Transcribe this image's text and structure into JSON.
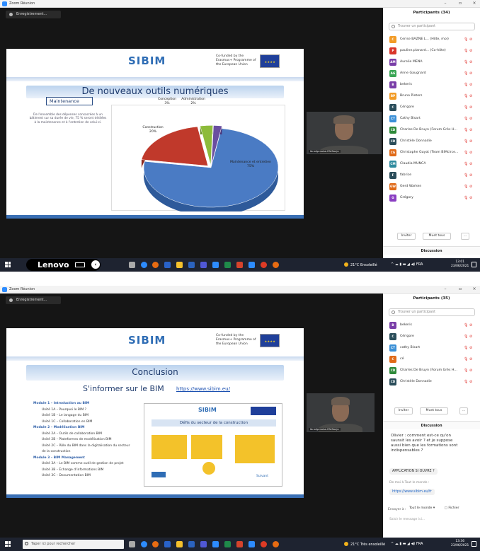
{
  "screenshot1": {
    "app_title": "Zoom Réunion",
    "recording_label": "Enregistrement...",
    "slide": {
      "logo": "SIBIM",
      "cofunded": "Co-funded by the Erasmus+ Programme of the European Union",
      "title": "De nouveaux outils numériques",
      "box_label": "Maintenance",
      "description": "De l'ensemble des dépenses consacrées à un bâtiment sur sa durée de vie, 75 % seront dédiées à la maintenance et à l'entretien de celui-ci."
    },
    "chart_data": {
      "type": "pie",
      "categories": [
        "Maintenance et entretien",
        "Construction",
        "Conception",
        "Administration"
      ],
      "values": [
        75,
        20,
        3,
        2
      ],
      "value_labels": [
        "75%",
        "20%",
        "3%",
        "2%"
      ]
    },
    "video_name": "Ibnafgenoise.EN.Boujo"
  },
  "panel1": {
    "title": "Participants (34)",
    "search_placeholder": "Trouver un participant",
    "participants": [
      {
        "initials": "C",
        "name": "Cerise BAZNE L... (Hôte, moi)",
        "color": "#f29b26"
      },
      {
        "initials": "P",
        "name": "pauline.planard... (Co-hôte)",
        "color": "#d9362b"
      },
      {
        "initials": "AM",
        "name": "Aurelie MENA",
        "color": "#7a3ea8"
      },
      {
        "initials": "AG",
        "name": "Anne Gaugnard",
        "color": "#3aa655"
      },
      {
        "initials": "B",
        "name": "bekeris",
        "color": "#7a3ea8"
      },
      {
        "initials": "BP",
        "name": "Bruno Pieters",
        "color": "#f29b26"
      },
      {
        "initials": "C",
        "name": "Cérigore",
        "color": "#2a4d5a"
      },
      {
        "initials": "CT",
        "name": "Cathy Bisart",
        "color": "#3a8fd6"
      },
      {
        "initials": "CD",
        "name": "Charles De Bruyn (Forum Grès H...",
        "color": "#2e8a3a"
      },
      {
        "initials": "CD",
        "name": "Christèle Donnadie",
        "color": "#2a4d5a"
      },
      {
        "initials": "CG",
        "name": "Christophe Guyot (Team BIMcirce...",
        "color": "#e06a18"
      },
      {
        "initials": "CM",
        "name": "Claudia MUNCA",
        "color": "#2e8a9e"
      },
      {
        "initials": "F",
        "name": "fabrice",
        "color": "#2a4d5a"
      },
      {
        "initials": "GW",
        "name": "Gerd Warken",
        "color": "#e06a18"
      },
      {
        "initials": "G",
        "name": "Grégory",
        "color": "#8a3ec2"
      }
    ],
    "invite": "Inviter",
    "mute_all": "Muet tous",
    "more": "...",
    "discussion": "Discussion"
  },
  "taskbar1": {
    "brand": "Lenovo",
    "weather": "21°C Ensoleillé",
    "lang": "FRA",
    "time": "13:01",
    "date": "23/06/2021"
  },
  "screenshot2": {
    "app_title": "Zoom Réunion",
    "recording_label": "Enregistrement...",
    "slide": {
      "logo": "SIBIM",
      "cofunded": "Co-funded by the Erasmus+ Programme of the European Union",
      "title": "Conclusion",
      "subtitle": "S'informer sur le BIM",
      "url": "https://www.sibim.eu/",
      "modules": [
        {
          "text": "Module 1 – Introduction au BIM",
          "head": true
        },
        {
          "text": "Unité 1A – Pourquoi le BIM ?",
          "head": false
        },
        {
          "text": "Unité 1B – Le langage du BIM",
          "head": false
        },
        {
          "text": "Unité 1C – Collaboration en BIM",
          "head": false
        },
        {
          "text": "Module 2 – Modélisation BIM",
          "head": true
        },
        {
          "text": "Unité 2A – Outils de collaboration BIM",
          "head": false
        },
        {
          "text": "Unité 2B – Plateformes de modélisation BIM",
          "head": false
        },
        {
          "text": "Unité 2C – Rôle du BIM dans la digitalisation du secteur",
          "head": false
        },
        {
          "text": "de la construction",
          "head": false
        },
        {
          "text": "Module 3 – BIM Management",
          "head": true
        },
        {
          "text": "Unité 3A – Le BIM comme outil de gestion de projet",
          "head": false
        },
        {
          "text": "Unité 3B – Échange d'informations BIM",
          "head": false
        },
        {
          "text": "Unité 3C – Documentation BIM",
          "head": false
        }
      ],
      "mini_title": "Défis du secteur de la construction",
      "mini_next": "Suivant"
    },
    "video_name": "Ibnafgenoise.EN.Boujo"
  },
  "panel2": {
    "title": "Participants (35)",
    "search_placeholder": "Trouver un participant",
    "participants": [
      {
        "initials": "B",
        "name": "bekeris",
        "color": "#7a3ea8"
      },
      {
        "initials": "C",
        "name": "Cérigore",
        "color": "#2a4d5a"
      },
      {
        "initials": "CT",
        "name": "cathy Bisart",
        "color": "#3a8fd6"
      },
      {
        "initials": "C",
        "name": "cé",
        "color": "#e06a18"
      },
      {
        "initials": "CD",
        "name": "Charles De Bruyn (Forum Grès H...",
        "color": "#2e8a3a"
      },
      {
        "initials": "CD",
        "name": "Christèle Donnadie",
        "color": "#2a4d5a"
      }
    ],
    "invite": "Inviter",
    "mute_all": "Muet tous",
    "more": "...",
    "discussion": "Discussion",
    "chat_message": "Olivier : comment est-ce qu'on saurait les avoir ? et je suppose aussi bien que les formations sont indispensables ?",
    "chat_chip": "APPLICATION SI OUVRE ?",
    "chat_to": "De moi à Tout le monde :",
    "chat_link": "https://www.sibim.eu/fr",
    "send_to_label": "Envoyer à :",
    "send_to_value": "Tout le monde",
    "file_label": "Fichier",
    "compose_placeholder": "Saisir le message ici..."
  },
  "taskbar2": {
    "search_placeholder": "Taper ici pour rechercher",
    "weather": "21°C Très ensoleillé",
    "lang": "FRA",
    "time": "13:36",
    "date": "23/06/2021"
  }
}
